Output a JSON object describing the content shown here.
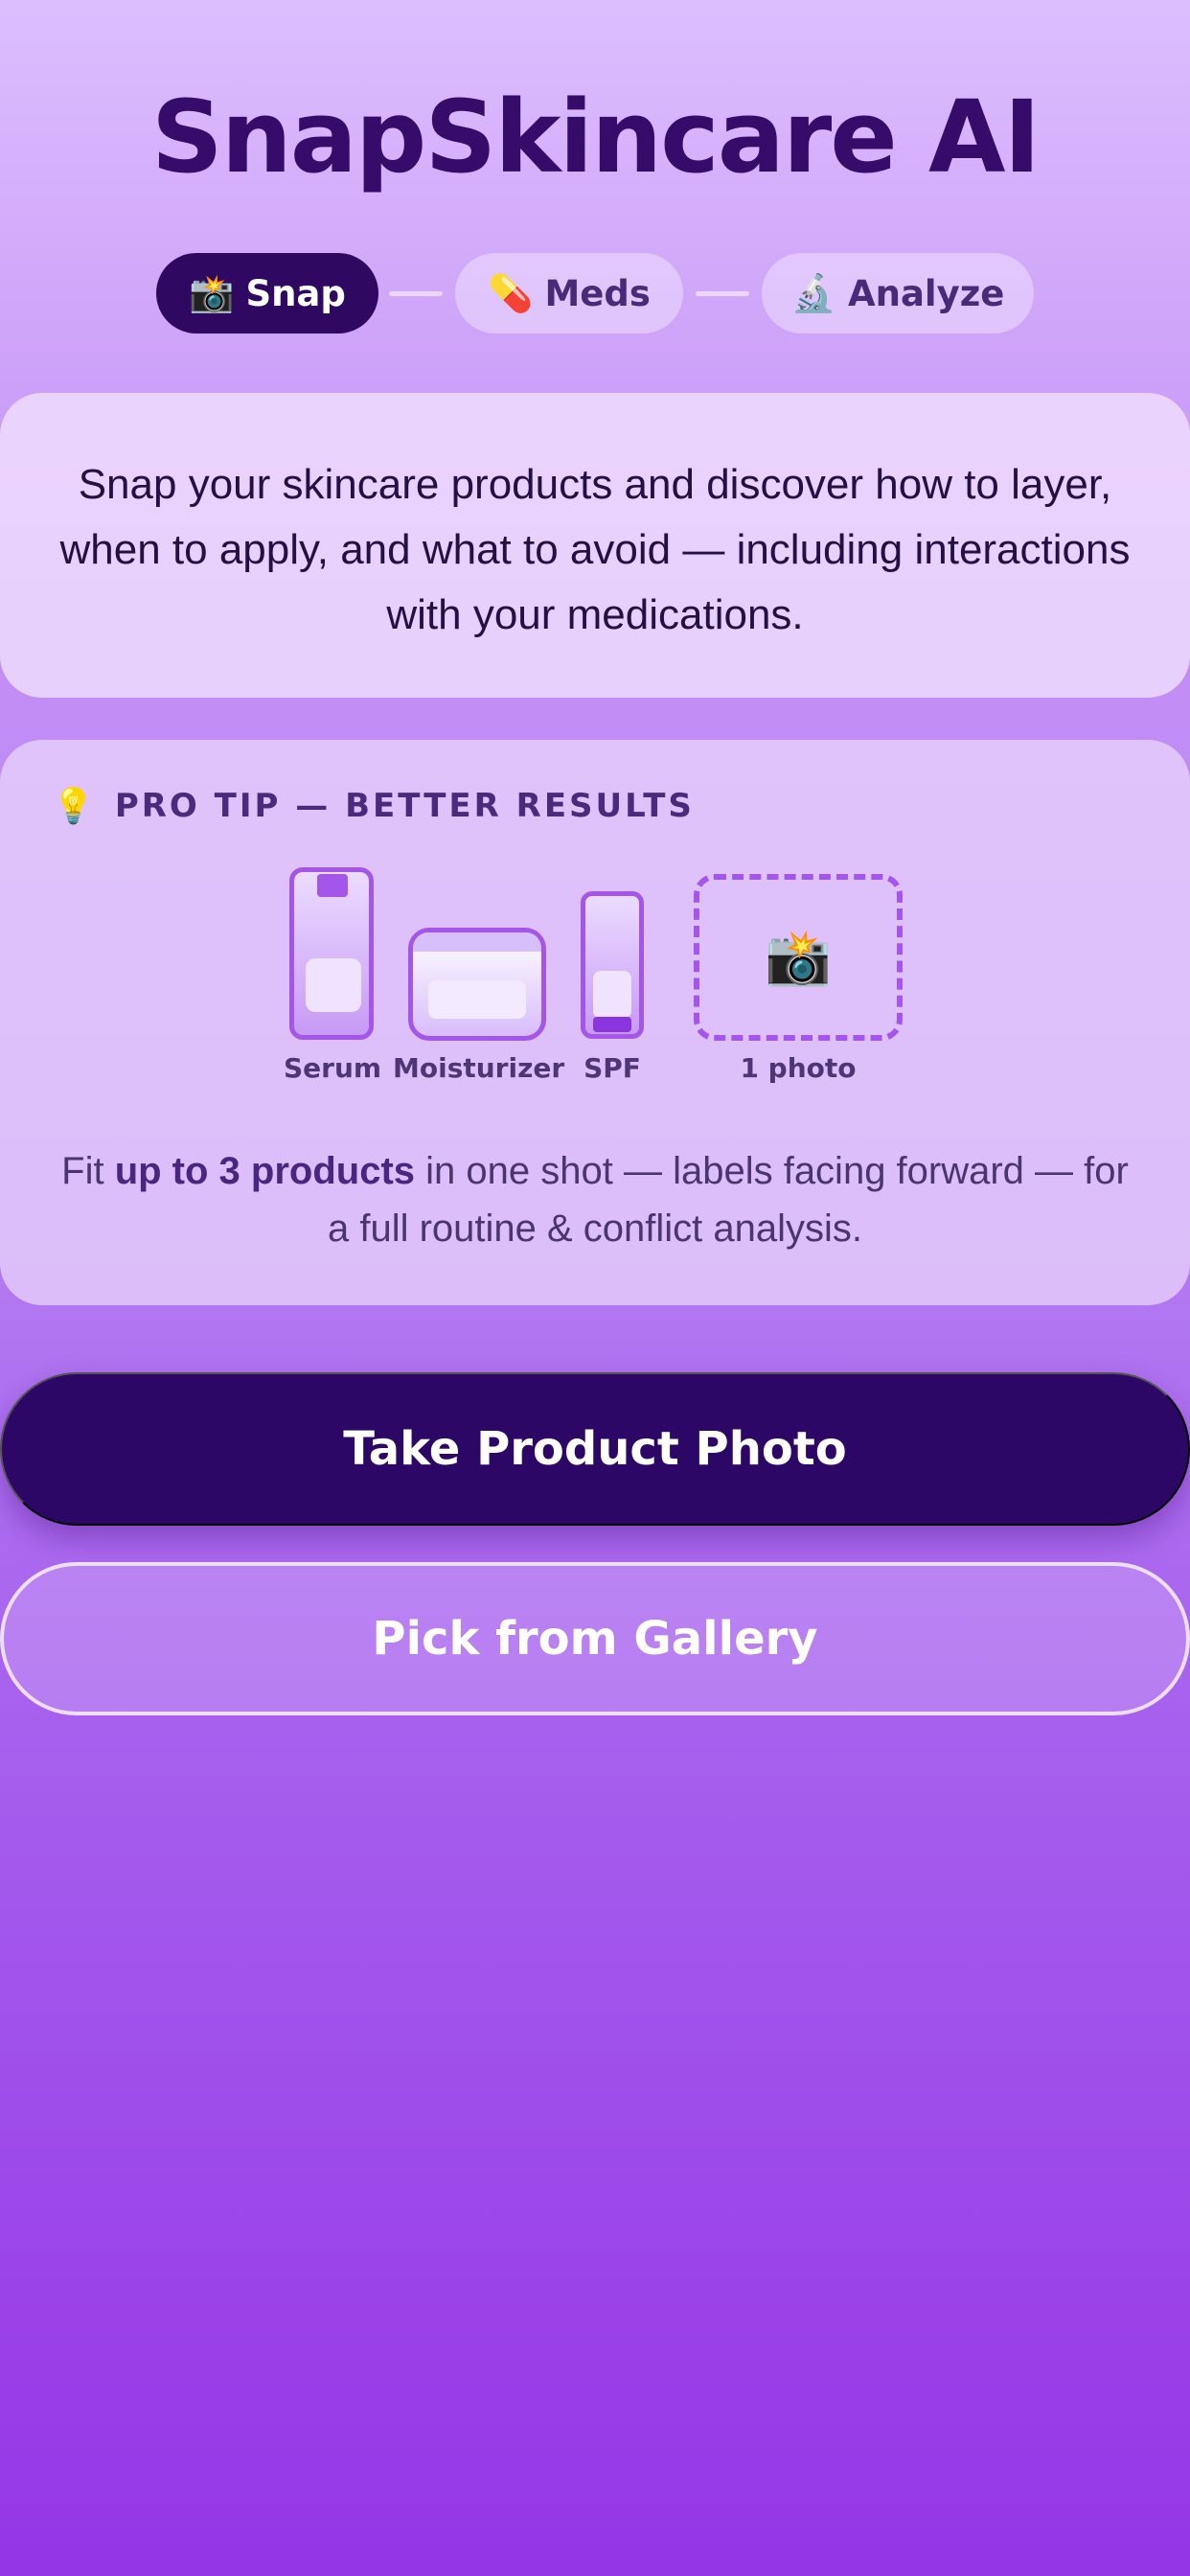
{
  "header": {
    "title": "SnapSkincare AI"
  },
  "stepper": {
    "steps": [
      {
        "emoji": "📸",
        "label": "Snap",
        "state": "active"
      },
      {
        "emoji": "💊",
        "label": "Meds",
        "state": "inactive"
      },
      {
        "emoji": "🔬",
        "label": "Analyze",
        "state": "inactive"
      }
    ]
  },
  "intro": {
    "text": "Snap your skincare products and discover how to layer, when to apply, and what to avoid — including interactions with your medications."
  },
  "pro_tip": {
    "emoji": "💡",
    "title": "PRO TIP — BETTER RESULTS",
    "illustration": {
      "products": [
        "Serum",
        "Moisturizer",
        "SPF"
      ],
      "photo_label": "1 photo",
      "photo_emoji": "📸"
    },
    "text_prefix": "Fit ",
    "text_bold": "up to 3 products",
    "text_suffix": " in one shot — labels facing forward — for a full routine & conflict analysis."
  },
  "actions": {
    "primary_label": "Take Product Photo",
    "secondary_label": "Pick from Gallery"
  },
  "colors": {
    "accent_dark": "#2d0766",
    "accent_purple": "#a455ea",
    "title_color": "#360c6a"
  }
}
